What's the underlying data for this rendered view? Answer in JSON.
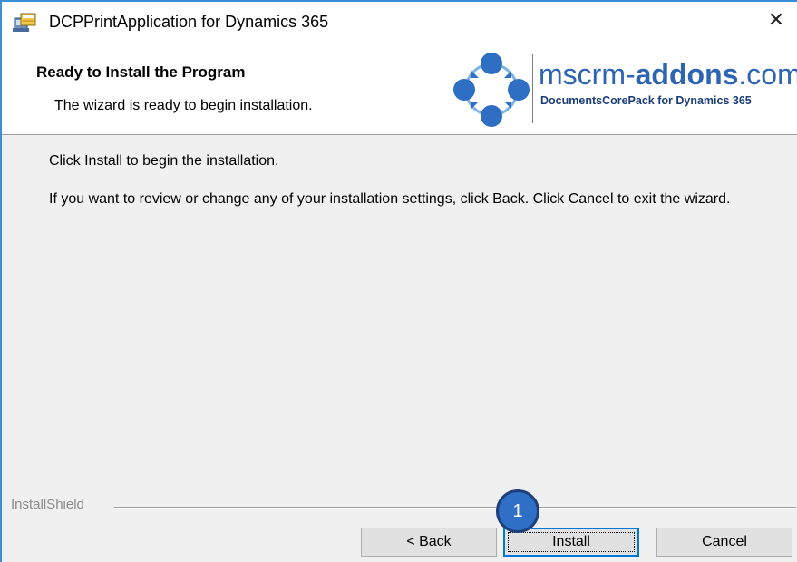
{
  "window": {
    "title": "DCPPrintApplication for Dynamics 365",
    "close_glyph": "✕",
    "app_icon": "installer-icon"
  },
  "header": {
    "title": "Ready to Install the Program",
    "subtitle": "The wizard is ready to begin installation.",
    "brand": {
      "name_prefix": "mscrm-",
      "name_bold": "addons",
      "name_suffix": ".com",
      "tagline": "DocumentsCorePack for Dynamics 365",
      "logo": "mscrm-addons-logo"
    }
  },
  "body": {
    "instruction": "Click Install to begin the installation.",
    "review_text": "If you want to review or change any of your installation settings, click Back. Click Cancel to exit the wizard."
  },
  "footer": {
    "vendor_label": "InstallShield",
    "buttons": {
      "back": {
        "prefix": "< ",
        "accel": "B",
        "rest": "ack"
      },
      "install": {
        "accel": "I",
        "rest": "nstall"
      },
      "cancel": {
        "label": "Cancel"
      }
    }
  },
  "annotation": {
    "step_number": "1"
  },
  "colors": {
    "accent": "#0078d7",
    "brand_blue": "#2e64b4",
    "badge_blue": "#2f6fc6",
    "window_border": "#3a8fd6"
  }
}
